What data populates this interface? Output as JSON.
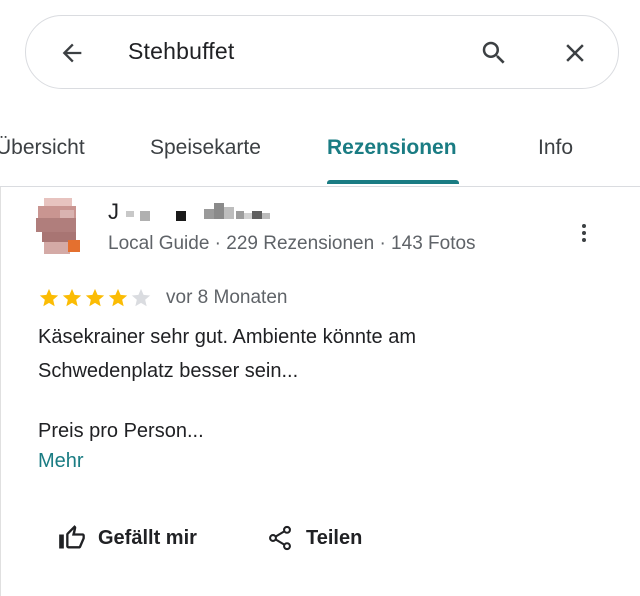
{
  "search": {
    "query": "Stehbuffet"
  },
  "icons": {
    "back": "arrow-back-icon",
    "search": "search-icon",
    "close": "close-icon",
    "more": "more-vert-icon",
    "like": "thumb-up-icon",
    "share": "share-icon",
    "star": "star-icon"
  },
  "colors": {
    "accent": "#1a7c83",
    "star_filled": "#fbbc04",
    "star_empty": "#dadce0",
    "secondary_text": "#5f6368"
  },
  "tabs": [
    {
      "label": "Übersicht",
      "active": false
    },
    {
      "label": "Speisekarte",
      "active": false
    },
    {
      "label": "Rezensionen",
      "active": true
    },
    {
      "label": "Info",
      "active": false
    }
  ],
  "review": {
    "reviewer_name_visible": "J",
    "reviewer_meta": "Local Guide · 229 Rezensionen · 143 Fotos",
    "rating": 4,
    "rating_max": 5,
    "age": "vor 8 Monaten",
    "text_line1": "Käsekrainer sehr gut. Ambiente könnte am",
    "text_line2": "Schwedenplatz besser sein...",
    "price_label": "Preis pro Person...",
    "more_link": "Mehr"
  },
  "actions": {
    "like_label": "Gefällt mir",
    "share_label": "Teilen"
  }
}
